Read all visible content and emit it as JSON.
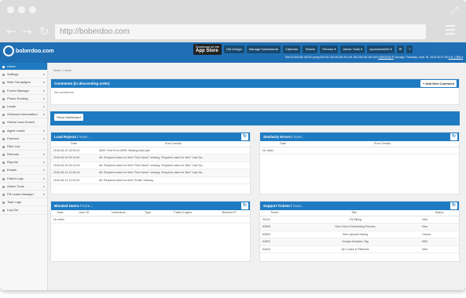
{
  "browser": {
    "url": "http://boberdoo.com"
  },
  "app": {
    "logo_text": "boberdoo.com",
    "appstore": {
      "top": "Download on the",
      "main": "App Store"
    },
    "toolbar": [
      "Old Design",
      "Manage Dashboards",
      "Calendar",
      "Tickets",
      "Themes ▾",
      "Admin Tools ▾",
      "superadmin99 ▾"
    ],
    "info_line": "Ref:13.204.55.149.52 proxy:204.93.149.45,204.93.149.150,204.55.149.153",
    "info_link": "HIDEDOS ®",
    "info_date": "Chicago: Thursday, June 16, 2016 02:47:28",
    "currency": "U.S. CRM ▾"
  },
  "sidebar": {
    "items": [
      {
        "label": "Home",
        "caret": ""
      },
      {
        "label": "Settings",
        "caret": "▸"
      },
      {
        "label": "Web Campaigns",
        "caret": "▸"
      },
      {
        "label": "Forms Manager",
        "caret": "▸"
      },
      {
        "label": "Phone Routing",
        "caret": "▸"
      },
      {
        "label": "Leads",
        "caret": "▸"
      },
      {
        "label": "Outbound Automation",
        "caret": "▸"
      },
      {
        "label": "Global Lead Search",
        "caret": ""
      },
      {
        "label": "Agent Leads",
        "caret": "▸"
      },
      {
        "label": "Partners",
        "caret": "▸"
      },
      {
        "label": "Filter List",
        "caret": ""
      },
      {
        "label": "Refunds",
        "caret": "▸"
      },
      {
        "label": "Reports",
        "caret": "▸"
      },
      {
        "label": "Emails",
        "caret": "▸"
      },
      {
        "label": "Failed Logs",
        "caret": "▸"
      },
      {
        "label": "Admin Tools",
        "caret": "▸"
      },
      {
        "label": "FB Leads Manager",
        "caret": "▸"
      },
      {
        "label": "Task Logs",
        "caret": ""
      },
      {
        "label": "Log Out",
        "caret": ""
      }
    ]
  },
  "breadcrumb": "Home > Home",
  "comments": {
    "title": "Comments (in descending order)",
    "add_label": "+ Add New Comment",
    "empty": "No comments"
  },
  "dashboard": {
    "show_label": "Show Dashboard"
  },
  "load_rejects": {
    "title": "Load Rejects /",
    "more": "more...",
    "columns": [
      "Date",
      "Error Details"
    ],
    "rows": [
      [
        "2016-06-15 15:39:43",
        "#509: Post Error #509: Missing lead type"
      ],
      [
        "2016-06-15 09:13:40",
        "#6: Required value for field \"First Name\" missing, Required value for field \"Last Na..."
      ],
      [
        "2016-06-15 09:13:03",
        "#6: Required value for field \"First Name\" missing, Required value for field \"Last Na..."
      ],
      [
        "2016-06-14 21:08:18",
        "#6: Required value for field \"First Name\" missing, Required value for field \"Last Na..."
      ],
      [
        "2016-06-14 12:03:43",
        "#6: Required value for field \"Email\" missing."
      ]
    ]
  },
  "similarity_errors": {
    "title": "Similarity Errors /",
    "more": "more...",
    "columns": [
      "Date",
      "Error Details"
    ],
    "empty": "No data!"
  },
  "blocked_users": {
    "title": "Blocked Users /",
    "more": "more...",
    "columns": [
      "Date",
      "User ID",
      "Username",
      "Type",
      "Failed Logins",
      "Blocked IP"
    ],
    "empty": "No data!"
  },
  "support_tickets": {
    "title": "Support Tickets /",
    "more": "more...",
    "columns": [
      "Ticket",
      "Title",
      "Status"
    ],
    "rows": [
      [
        "33141",
        "CN Billing",
        "New"
      ],
      [
        "63695",
        "New Client Onboarding Process",
        "New"
      ],
      [
        "63653",
        "New zipcode testing",
        "Closed"
      ],
      [
        "63653",
        "Google Analytics Tag",
        "WIN"
      ],
      [
        "63643",
        "Zip Codes in Filterlists",
        "New"
      ]
    ]
  }
}
